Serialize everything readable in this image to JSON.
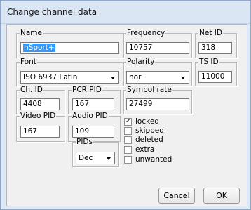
{
  "window": {
    "title": "Change channel data"
  },
  "name": {
    "label": "Name",
    "value": "nSport+"
  },
  "frequency": {
    "label": "Frequency",
    "value": "10757"
  },
  "net_id": {
    "label": "Net ID",
    "value": "318"
  },
  "font": {
    "label": "Font",
    "selected": "ISO 6937 Latin"
  },
  "polarity": {
    "label": "Polarity",
    "selected": "hor"
  },
  "ts_id": {
    "label": "TS ID",
    "value": "11000"
  },
  "ch_id": {
    "label": "Ch. ID",
    "value": "4408"
  },
  "pcr_pid": {
    "label": "PCR PID",
    "value": "167"
  },
  "symbol_rate": {
    "label": "Symbol rate",
    "value": "27499"
  },
  "video_pid": {
    "label": "Video PID",
    "value": "167"
  },
  "audio_pid": {
    "label": "Audio PID",
    "value": "109"
  },
  "pids": {
    "label": "PIDs",
    "selected": "Dec"
  },
  "flags": [
    {
      "label": "locked",
      "checked": true
    },
    {
      "label": "skipped",
      "checked": false
    },
    {
      "label": "deleted",
      "checked": false
    },
    {
      "label": "extra",
      "checked": false
    },
    {
      "label": "unwanted",
      "checked": false
    }
  ],
  "buttons": {
    "cancel": "Cancel",
    "ok": "OK"
  },
  "icons": {
    "check": "checkmark-icon",
    "dropdown": "chevron-down-icon"
  }
}
